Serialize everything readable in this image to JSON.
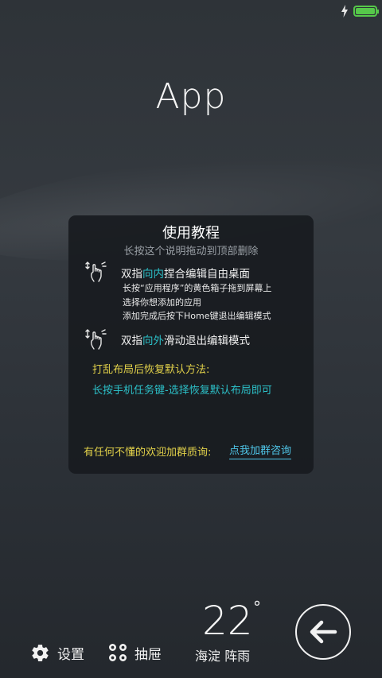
{
  "status_bar": {
    "charge_icon": "lightning-bolt-icon",
    "battery_icon": "battery-full-icon",
    "battery_color": "#56c84a"
  },
  "header": {
    "title": "App"
  },
  "tutorial": {
    "title": "使用教程",
    "subtitle": "长按这个说明拖动到顶部删除",
    "pinch_in": {
      "prefix": "双指",
      "highlight": "向内",
      "suffix": "捏合编辑自由桌面",
      "steps": [
        "长按“应用程序”的黄色箱子拖到屏幕上",
        "选择你想添加的应用",
        "添加完成后按下Home键退出编辑模式"
      ]
    },
    "pinch_out": {
      "prefix": "双指",
      "highlight": "向外",
      "suffix": "滑动退出编辑模式"
    },
    "restore_title": "打乱布局后恢复默认方法:",
    "restore_desc": "长按手机任务键-选择恢复默认布局即可",
    "help_text": "有任何不懂的欢迎加群质询:",
    "help_link": "点我加群咨询",
    "colors": {
      "highlight": "#2cc0c8",
      "warning": "#e3d24a",
      "link": "#4fc6e8"
    }
  },
  "bottom_bar": {
    "settings_label": "设置",
    "drawer_label": "抽屉",
    "temperature": "22",
    "degree_symbol": "°",
    "weather": "海淀 阵雨",
    "back_icon": "back-arrow-icon"
  }
}
